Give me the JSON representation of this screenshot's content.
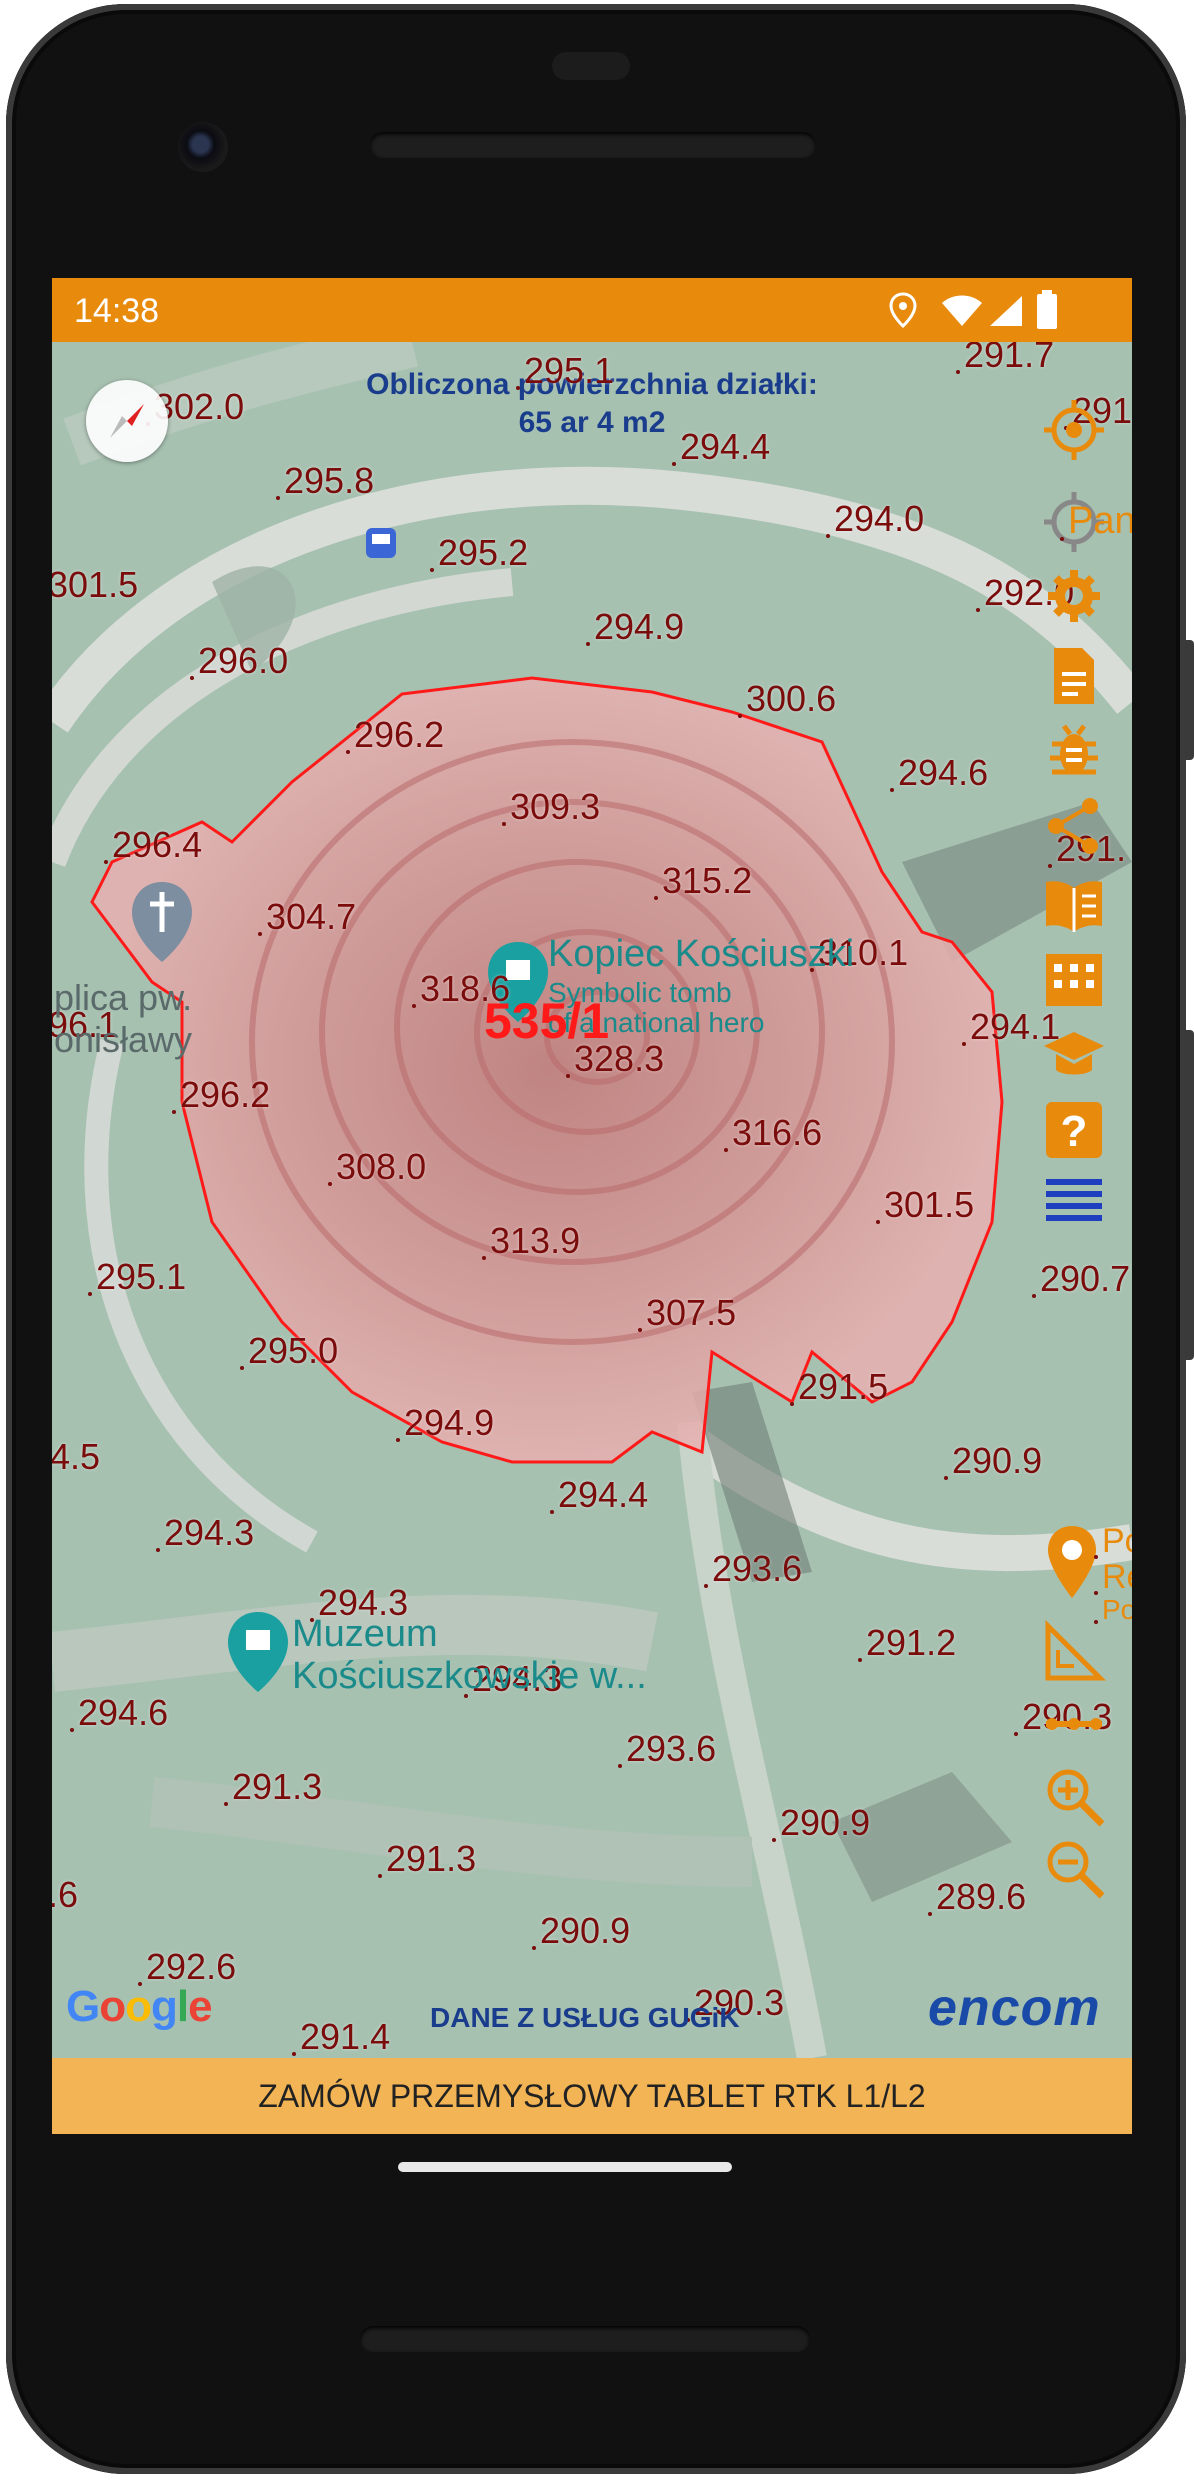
{
  "status_bar": {
    "time": "14:38"
  },
  "map": {
    "area_info_line1": "Obliczona powierzchnia działki:",
    "area_info_line2": "65 ar 4 m2",
    "parcel_id": "535/1",
    "poi": {
      "kopiec_name": "Kopiec Kościuszki",
      "kopiec_sub1": "Symbolic tomb",
      "kopiec_sub2": "of a national hero",
      "muzeum_line1": "Muzeum",
      "muzeum_line2": "Kościuszkowskie w...",
      "kaplica_line1": "plica pw.",
      "kaplica_line2": "onisławy",
      "pano_label": "Pano",
      "right_poi_1": "Po",
      "right_poi_2": "Re",
      "right_poi_3": "Po"
    },
    "heights": [
      {
        "id": "h1",
        "v": "295.1"
      },
      {
        "id": "h2",
        "v": "291.7"
      },
      {
        "id": "h3",
        "v": "302.0"
      },
      {
        "id": "h4",
        "v": "291"
      },
      {
        "id": "h5",
        "v": "295.8"
      },
      {
        "id": "h6",
        "v": "294.4"
      },
      {
        "id": "h7",
        "v": "294.0"
      },
      {
        "id": "h8",
        "v": "295.2"
      },
      {
        "id": "h9",
        "v": "301.5"
      },
      {
        "id": "h10",
        "v": "292.0"
      },
      {
        "id": "h11",
        "v": "294.9"
      },
      {
        "id": "h12",
        "v": "296.0"
      },
      {
        "id": "h13",
        "v": "300.6"
      },
      {
        "id": "h14",
        "v": "296.2"
      },
      {
        "id": "h15",
        "v": "294.6"
      },
      {
        "id": "h16",
        "v": "309.3"
      },
      {
        "id": "h17",
        "v": "296.4"
      },
      {
        "id": "h18",
        "v": "291."
      },
      {
        "id": "h19",
        "v": "315.2"
      },
      {
        "id": "h20",
        "v": "304.7"
      },
      {
        "id": "h21",
        "v": "310.1"
      },
      {
        "id": "h22",
        "v": "318.6"
      },
      {
        "id": "h23",
        "v": "96.1"
      },
      {
        "id": "h24",
        "v": "294.1"
      },
      {
        "id": "h25",
        "v": "328.3"
      },
      {
        "id": "h26",
        "v": "296.2"
      },
      {
        "id": "h27",
        "v": "316.6"
      },
      {
        "id": "h28",
        "v": "308.0"
      },
      {
        "id": "h29",
        "v": "301.5"
      },
      {
        "id": "h30",
        "v": "313.9"
      },
      {
        "id": "h31",
        "v": "295.1"
      },
      {
        "id": "h32",
        "v": "290.7"
      },
      {
        "id": "h33",
        "v": "307.5"
      },
      {
        "id": "h34",
        "v": "295.0"
      },
      {
        "id": "h35",
        "v": "291.5"
      },
      {
        "id": "h36",
        "v": "294.9"
      },
      {
        "id": "h37",
        "v": "4.5"
      },
      {
        "id": "h38",
        "v": "290.9"
      },
      {
        "id": "h39",
        "v": "294.4"
      },
      {
        "id": "h40",
        "v": "294.3"
      },
      {
        "id": "h41",
        "v": "293.6"
      },
      {
        "id": "h42",
        "v": "294.3"
      },
      {
        "id": "h43",
        "v": "291.2"
      },
      {
        "id": "h44",
        "v": "294.3"
      },
      {
        "id": "h45",
        "v": "294.6"
      },
      {
        "id": "h46",
        "v": "290.3"
      },
      {
        "id": "h47",
        "v": "293.6"
      },
      {
        "id": "h48",
        "v": "291.3"
      },
      {
        "id": "h49",
        "v": "290.9"
      },
      {
        "id": "h50",
        "v": "291.3"
      },
      {
        "id": "h51",
        "v": ".6"
      },
      {
        "id": "h52",
        "v": "289.6"
      },
      {
        "id": "h53",
        "v": "290.9"
      },
      {
        "id": "h54",
        "v": "292.6"
      },
      {
        "id": "h55",
        "v": "290.3"
      },
      {
        "id": "h56",
        "v": "291.4"
      }
    ],
    "google_logo": "Google",
    "data_source": "DANE Z USŁUG GUGiK",
    "brand_logo": "encom"
  },
  "side_toolbar": {
    "icons": [
      "locate-icon",
      "pano-icon",
      "settings-icon",
      "document-icon",
      "bug-icon",
      "share-icon",
      "book-icon",
      "building-icon",
      "education-icon",
      "help-icon",
      "menu-icon",
      "poi-add-icon",
      "measure-icon",
      "ruler-icon",
      "zoom-in-icon",
      "zoom-out-icon"
    ]
  },
  "banner": {
    "text": "ZAMÓW PRZEMYSŁOWY TABLET RTK L1/L2"
  },
  "colors": {
    "accent": "#e88a0c",
    "banner": "#f2b455",
    "height_label": "#7a0c0c",
    "parcel_fill": "#e89a9a",
    "parcel_stroke": "#ff0000",
    "area_info": "#1a3c8c"
  }
}
